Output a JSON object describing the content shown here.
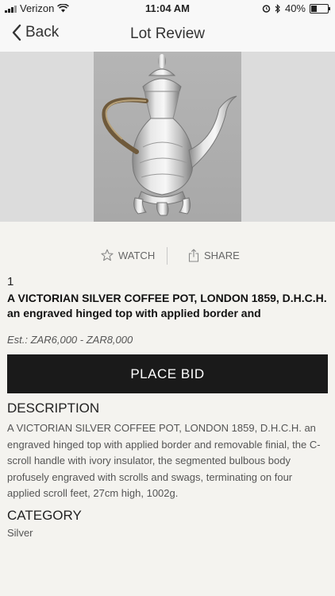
{
  "status_bar": {
    "carrier": "Verizon",
    "time": "11:04 AM",
    "battery": "40%",
    "battery_level": 0.4,
    "icons": [
      "signal-icon",
      "wifi-icon",
      "alarm-icon",
      "bluetooth-icon",
      "battery-icon"
    ]
  },
  "nav": {
    "back_label": "Back",
    "title": "Lot Review"
  },
  "actions": {
    "watch_label": "WATCH",
    "share_label": "SHARE"
  },
  "lot": {
    "number": "1",
    "title": "A VICTORIAN SILVER COFFEE POT, LONDON 1859, D.H.C.H. an engraved hinged top with applied border and",
    "estimate": "Est.: ZAR6,000 - ZAR8,000"
  },
  "bid_button": "PLACE BID",
  "description": {
    "heading": "DESCRIPTION",
    "text": "A VICTORIAN SILVER COFFEE POT, LONDON 1859, D.H.C.H. an engraved hinged top with applied border and removable finial, the C-scroll handle with ivory insulator, the segmented bulbous body profusely engraved with scrolls and swags, terminating on four applied scroll feet, 27cm high, 1002g."
  },
  "category": {
    "heading": "CATEGORY",
    "value": "Silver"
  },
  "colors": {
    "background": "#f4f3ef",
    "button": "#1a1a1a",
    "image_backdrop": "#dcdcdc"
  }
}
